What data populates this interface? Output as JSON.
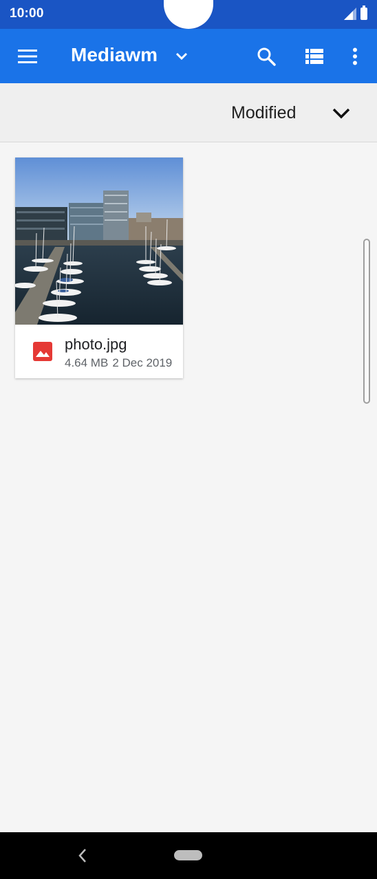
{
  "status_bar": {
    "time": "10:00",
    "icons": [
      "signal-icon",
      "battery-icon"
    ]
  },
  "app_bar": {
    "title": "Mediawm",
    "icons": [
      "menu-icon",
      "chevron-down-icon",
      "search-icon",
      "list-view-icon",
      "more-vert-icon"
    ],
    "color": "#1a73e8"
  },
  "sort_bar": {
    "label": "Modified",
    "icon": "chevron-down-icon"
  },
  "files": [
    {
      "name": "photo.jpg",
      "size": "4.64 MB",
      "date": "2 Dec 2019",
      "type_icon": "image-file-icon",
      "icon_color": "#e53935"
    }
  ],
  "nav_bar": {
    "icons": [
      "back-icon",
      "home-pill"
    ]
  }
}
